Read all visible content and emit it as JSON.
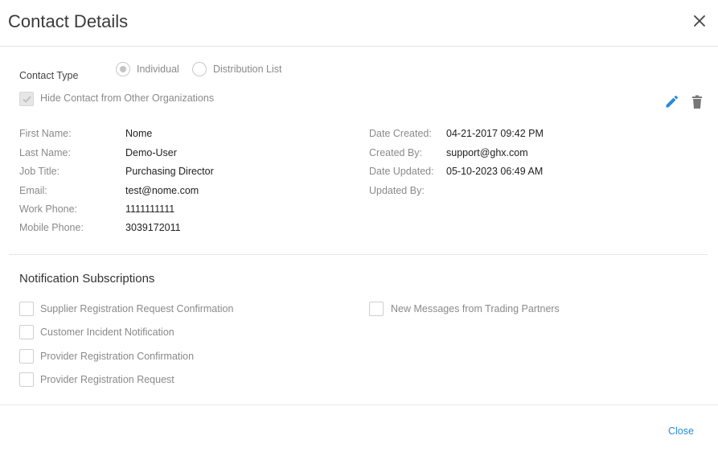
{
  "dialog": {
    "title": "Contact Details",
    "close_icon": "close-icon"
  },
  "contact_type": {
    "label": "Contact Type",
    "options": [
      {
        "label": "Individual",
        "selected": true
      },
      {
        "label": "Distribution List",
        "selected": false
      }
    ]
  },
  "hide_contact": {
    "label": "Hide Contact from Other Organizations",
    "checked": true
  },
  "actions": {
    "edit_icon": "pencil-icon",
    "delete_icon": "trash-icon",
    "edit_color": "#2a8bd6",
    "delete_color": "#777777"
  },
  "details_left": [
    {
      "label": "First Name:",
      "value": "Nome"
    },
    {
      "label": "Last Name:",
      "value": "Demo-User"
    },
    {
      "label": "Job Title:",
      "value": "Purchasing Director"
    },
    {
      "label": "Email:",
      "value": "test@nome.com"
    },
    {
      "label": "Work Phone:",
      "value": "1111111111"
    },
    {
      "label": "Mobile Phone:",
      "value": "3039172011"
    }
  ],
  "details_right": [
    {
      "label": "Date Created:",
      "value": "04-21-2017 09:42 PM"
    },
    {
      "label": "Created By:",
      "value": "support@ghx.com"
    },
    {
      "label": "Date Updated:",
      "value": "05-10-2023 06:49 AM"
    },
    {
      "label": "Updated By:",
      "value": ""
    }
  ],
  "notifications": {
    "title": "Notification Subscriptions",
    "left": [
      {
        "label": "Supplier Registration Request Confirmation",
        "checked": false
      },
      {
        "label": "Customer Incident Notification",
        "checked": false
      },
      {
        "label": "Provider Registration Confirmation",
        "checked": false
      },
      {
        "label": "Provider Registration Request",
        "checked": false
      }
    ],
    "right": [
      {
        "label": "New Messages from Trading Partners",
        "checked": false
      }
    ]
  },
  "footer": {
    "close_label": "Close",
    "link_color": "#2a8bd6"
  }
}
